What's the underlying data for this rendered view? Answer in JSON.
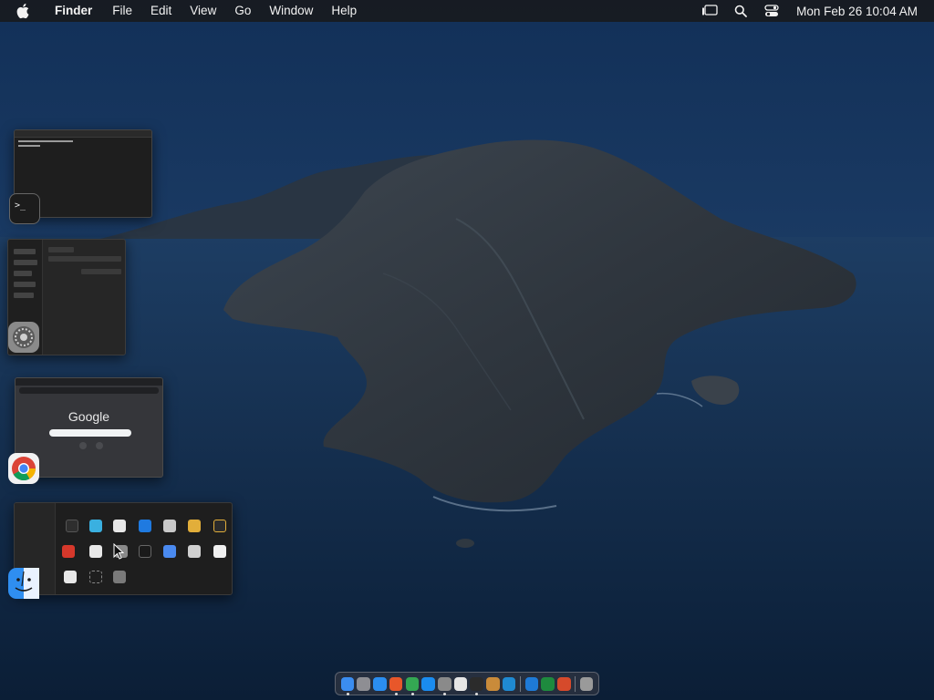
{
  "menubar": {
    "app_name": "Finder",
    "items": [
      "File",
      "Edit",
      "View",
      "Go",
      "Window",
      "Help"
    ],
    "clock": "Mon Feb 26  10:04 AM",
    "status_icons": [
      "stage-manager-icon",
      "search-icon",
      "control-center-icon"
    ]
  },
  "stage_manager": {
    "windows": [
      {
        "app": "Terminal",
        "icon": "terminal-icon"
      },
      {
        "app": "System Settings",
        "icon": "settings-icon"
      },
      {
        "app": "Google Chrome",
        "icon": "chrome-icon",
        "page_text": "Google"
      },
      {
        "app": "Finder",
        "icon": "finder-icon"
      }
    ]
  },
  "dock": {
    "apps": [
      {
        "name": "Finder",
        "icon": "finder-icon",
        "color": "#3b8df0",
        "running": true
      },
      {
        "name": "Launchpad",
        "icon": "launchpad-icon",
        "color": "#8e8e93",
        "running": false
      },
      {
        "name": "Safari",
        "icon": "safari-icon",
        "color": "#2b8ef0",
        "running": false
      },
      {
        "name": "Firefox",
        "icon": "firefox-icon",
        "color": "#e8572a",
        "running": true
      },
      {
        "name": "Chrome",
        "icon": "chrome-icon",
        "color": "#34a853",
        "running": true
      },
      {
        "name": "App Store",
        "icon": "appstore-icon",
        "color": "#1a8cf0",
        "running": false
      },
      {
        "name": "System Settings",
        "icon": "settings-icon",
        "color": "#8a8a8a",
        "running": true
      },
      {
        "name": "TextEdit",
        "icon": "textedit-icon",
        "color": "#e6e6e6",
        "running": false
      },
      {
        "name": "Terminal",
        "icon": "terminal-icon",
        "color": "#2b2b2b",
        "running": true
      },
      {
        "name": "Brush",
        "icon": "brush-icon",
        "color": "#c98b3a",
        "running": false
      },
      {
        "name": "VS Code",
        "icon": "vscode-icon",
        "color": "#1f8ad2",
        "running": false
      },
      {
        "name": "OneDrive",
        "icon": "onedrive-icon",
        "color": "#1e7ad6",
        "running": false
      },
      {
        "name": "Excel",
        "icon": "excel-icon",
        "color": "#1e8a3e",
        "running": false
      },
      {
        "name": "Photo Booth",
        "icon": "photobooth-icon",
        "color": "#d64a2b",
        "running": false
      },
      {
        "name": "Trash",
        "icon": "trash-icon",
        "color": "#9a9a9a",
        "running": false
      }
    ]
  }
}
